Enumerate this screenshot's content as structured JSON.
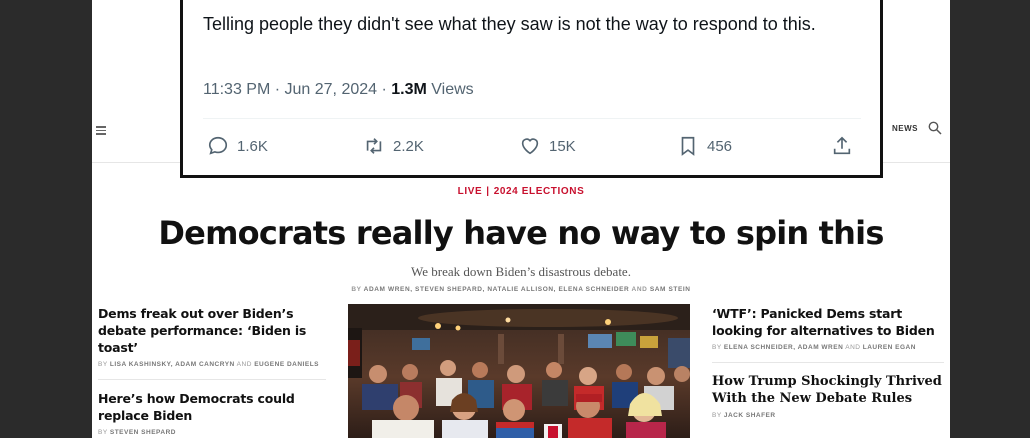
{
  "tweet": {
    "text": "Telling people they didn't see what they saw is not the way to respond to this.",
    "time": "11:33 PM · Jun 27, 2024 · ",
    "views_count": "1.3M",
    "views_label": " Views",
    "replies": "1.6K",
    "reposts": "2.2K",
    "likes": "15K",
    "bookmarks": "456"
  },
  "nav": {
    "news_label": "NEWS"
  },
  "article": {
    "eyebrow_live": "LIVE",
    "eyebrow_sep": "|",
    "eyebrow_topic": "2024 ELECTIONS",
    "headline": "Democrats really have no way to spin this",
    "dek": "We break down Biden’s disastrous debate.",
    "byline_by": "BY ",
    "byline_names": "ADAM WREN, STEVEN SHEPARD, NATALIE ALLISON, ELENA SCHNEIDER",
    "byline_and": " AND ",
    "byline_last": "SAM STEIN"
  },
  "left_stories": [
    {
      "title": "Dems freak out over Biden’s debate performance: ‘Biden is toast’",
      "by": "BY ",
      "names": "LISA KASHINSKY, ADAM CANCRYN",
      "and": " AND ",
      "last": "EUGENE DANIELS"
    },
    {
      "title": "Here’s how Democrats could replace Biden",
      "by": "BY ",
      "names": "STEVEN SHEPARD"
    }
  ],
  "right_stories": [
    {
      "title": "‘WTF’: Panicked Dems start looking for alternatives to Biden",
      "by": "BY ",
      "names": "ELENA SCHNEIDER, ADAM WREN",
      "and": " AND ",
      "last": "LAUREN EGAN"
    },
    {
      "title": "How Trump Shockingly Thrived With the New Debate Rules",
      "by": "BY ",
      "names": "JACK SHAFER"
    }
  ],
  "icons": {
    "reply": "reply-icon",
    "repost": "repost-icon",
    "like": "heart-icon",
    "bookmark": "bookmark-icon",
    "share": "share-icon",
    "menu": "hamburger-icon",
    "search": "search-icon"
  },
  "colors": {
    "accent_red": "#c8102e",
    "tweet_grey": "#536471"
  }
}
